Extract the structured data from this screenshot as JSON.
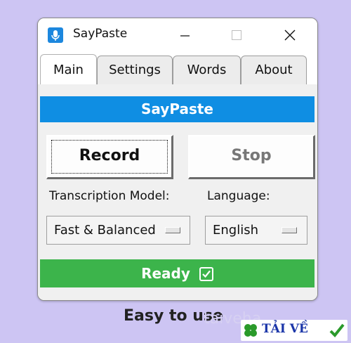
{
  "window": {
    "title": "SayPaste",
    "icon": "microphone-icon",
    "controls": [
      "minimize-icon",
      "maximize-icon",
      "close-icon"
    ]
  },
  "tabs": [
    {
      "label": "Main",
      "active": true
    },
    {
      "label": "Settings",
      "active": false
    },
    {
      "label": "Words",
      "active": false
    },
    {
      "label": "About",
      "active": false
    }
  ],
  "main": {
    "header": "SayPaste",
    "record_label": "Record",
    "stop_label": "Stop",
    "model_label": "Transcription Model:",
    "model_value": "Fast & Balanced",
    "language_label": "Language:",
    "language_value": "English",
    "status_text": "Ready",
    "status_icon": "check-box-icon"
  },
  "caption": "Easy to use",
  "watermark": {
    "site_text": "taiveha",
    "badge_text": "TẢI VỀ"
  },
  "colors": {
    "background": "#cdc5f3",
    "header_blue": "#0f8ee3",
    "status_green": "#3cb44b",
    "icon_blue": "#1c87de"
  }
}
